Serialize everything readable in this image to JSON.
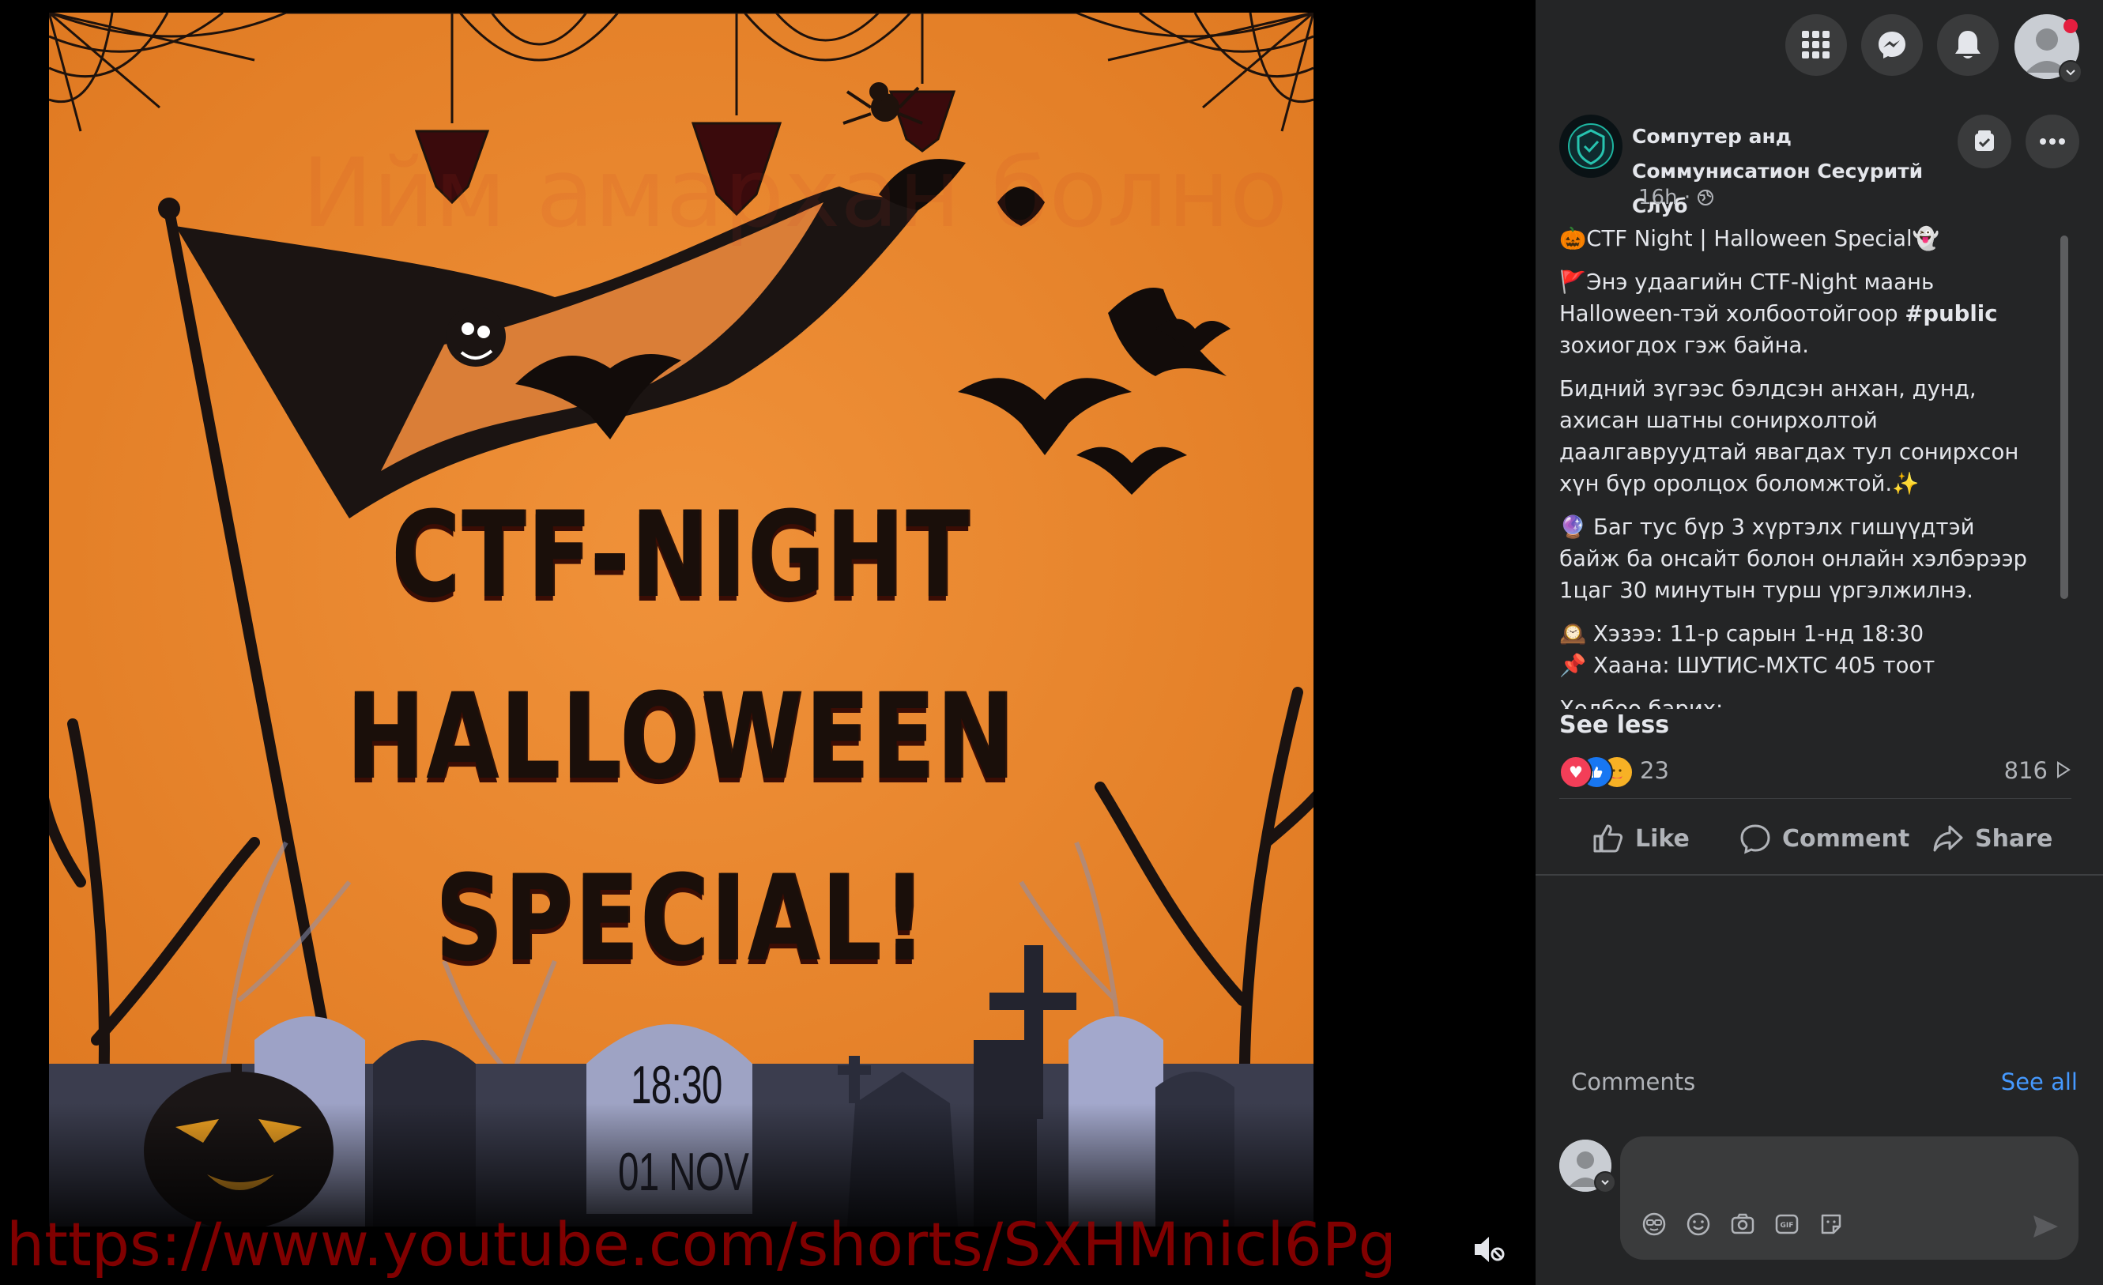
{
  "media": {
    "poster_lines": [
      "CTF-NIGHT",
      "HALLOWEEN",
      "SPECIAL!"
    ],
    "tombstone_time": "18:30",
    "tombstone_date": "01 NOV",
    "watermark_top": "Ийм амархан болно гэж мэдээгүй",
    "watermark_url": "https://www.youtube.com/shorts/SXHMnicl6Pg",
    "mute_icon": "muted-speaker-icon"
  },
  "topbar": {
    "menu_icon": "grid-menu-icon",
    "messenger_icon": "messenger-icon",
    "notifications_icon": "bell-icon",
    "account_icon": "account-avatar"
  },
  "post": {
    "page_name": "Сомпутер анд Соммунисатион Сесуритй Слуб",
    "time": "16h",
    "privacy_icon": "globe-icon",
    "paragraphs": [
      "🎃CTF Night | Halloween Special👻",
      "🚩Энэ удаагийн CTF-Night маань Halloween-тэй холбоотойгоор",
      "зохиогдох гэж байна.",
      "Бидний зүгээс бэлдсэн анхан, дунд, ахисан шатны сонирхолтой даалгавруудтай явагдах тул сонирхсон хүн бүр оролцох боломжтой.✨",
      "🔮 Баг тус бүр 3 хүртэлх гишүүдтэй байж ба онсайт болон онлайн хэлбэрээр 1цаг 30 минутын турш үргэлжилнэ.",
      "🕰️ Хэзээ: 11-р сарын 1-нд 18:30",
      "📌 Хаана: ШУТИС-МХТС 405 тоот",
      "Холбоо барих:"
    ],
    "hashtag": "#public",
    "see_less": "See less",
    "reaction_count": "23",
    "views": "816",
    "actions": {
      "like": "Like",
      "comment": "Comment",
      "share": "Share"
    }
  },
  "comments": {
    "heading": "Comments",
    "see_all": "See all",
    "placeholder": "",
    "tools": [
      "avatar-sticker-icon",
      "emoji-icon",
      "camera-icon",
      "gif-icon",
      "sticker-icon"
    ]
  },
  "colors": {
    "poster_orange": "#e98a2e",
    "panel_bg": "#242526",
    "link_blue": "#4599ff",
    "url_red": "#960000"
  }
}
